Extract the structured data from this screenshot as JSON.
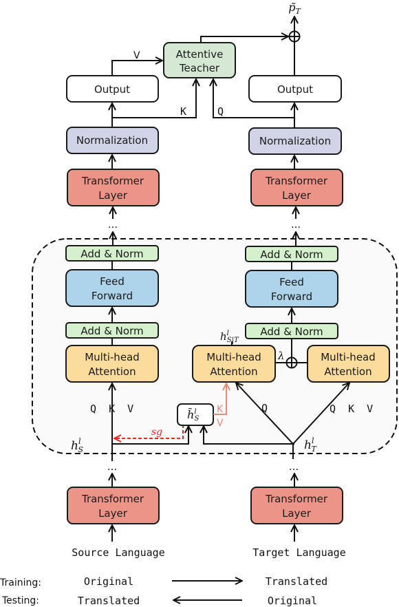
{
  "colors": {
    "output": "#ffffff",
    "attentive_teacher": "#d5e8d4",
    "normalization": "#d0d4e6",
    "transformer_layer": "#ec9488",
    "add_norm": "#d5f0cc",
    "feed_forward": "#add4ea",
    "multi_head_attention": "#fbdc9c",
    "block_background": "#fafafa",
    "stop_gradient": "#ff2020",
    "kv_projection": "#e48a7c"
  },
  "top": {
    "output_symbol": "p̃",
    "output_subscript": "T",
    "attentive_teacher_line1": "Attentive",
    "attentive_teacher_line2": "Teacher",
    "v_label": "V",
    "k_label": "K",
    "q_label": "Q"
  },
  "source": {
    "output": "Output",
    "normalization": "Normalization",
    "transformer_line1": "Transformer",
    "transformer_line2": "Layer",
    "ellipsis": "...",
    "add_norm_top": "Add & Norm",
    "feed_forward_line1": "Feed",
    "feed_forward_line2": "Forward",
    "add_norm_bottom": "Add & Norm",
    "mha_line1": "Multi-head",
    "mha_line2": "Attention",
    "qkv": "Q  K  V",
    "hidden_symbol": "h",
    "hidden_sup": "l",
    "hidden_sub": "S",
    "bottom_transformer_line1": "Transformer",
    "bottom_transformer_line2": "Layer",
    "language": "Source Language"
  },
  "target": {
    "output": "Output",
    "normalization": "Normalization",
    "transformer_line1": "Transformer",
    "transformer_line2": "Layer",
    "ellipsis": "...",
    "add_norm_top": "Add & Norm",
    "feed_forward_line1": "Feed",
    "feed_forward_line2": "Forward",
    "add_norm_bottom": "Add & Norm",
    "cross_mha_line1": "Multi-head",
    "cross_mha_line2": "Attention",
    "self_mha_line1": "Multi-head",
    "self_mha_line2": "Attention",
    "q_label": "Q",
    "qkv": "Q  K  V",
    "lambda": "λ",
    "cross_hidden_symbol": "h",
    "cross_hidden_sup": "l",
    "cross_hidden_sub": "S|T",
    "hidden_symbol": "h",
    "hidden_sup": "l",
    "hidden_sub": "T",
    "bottom_transformer_line1": "Transformer",
    "bottom_transformer_line2": "Layer",
    "language": "Target Language"
  },
  "projection": {
    "symbol": "h̃",
    "sup": "l",
    "sub": "S",
    "k_label": "K",
    "v_label": "V",
    "sg_label": "sg"
  },
  "legend": {
    "training_label": "Training:",
    "training_from": "Original",
    "training_to": "Translated",
    "testing_label": "Testing:",
    "testing_from": "Translated",
    "testing_to": "Original"
  }
}
